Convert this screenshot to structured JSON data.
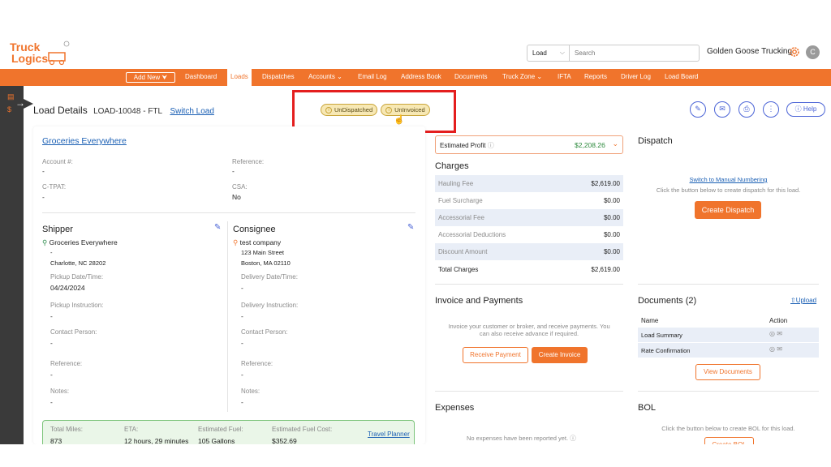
{
  "topbar": {
    "logo_text": "Truck Logics",
    "search_scope": "Load",
    "search_placeholder": "Search",
    "company": "Golden Goose Trucking",
    "avatar_initial": "C"
  },
  "nav": {
    "add_new": "Add New ⮟",
    "items": [
      "Dashboard",
      "Loads",
      "Dispatches",
      "Accounts ⌄",
      "Email Log",
      "Address Book",
      "Documents",
      "Truck Zone ⌄",
      "IFTA",
      "Reports",
      "Driver Log",
      "Load Board"
    ],
    "active": "Loads"
  },
  "header": {
    "title": "Load Details",
    "load_id": "LOAD-10048 - FTL",
    "switch_link": "Switch Load",
    "status_dispatch": "UnDispatched",
    "status_invoice": "UnInvoiced",
    "help": "Help"
  },
  "customer": {
    "name": "Groceries Everywhere",
    "account_label": "Account #:",
    "account_value": "-",
    "reference_label": "Reference:",
    "reference_value": "-",
    "ctpat_label": "C-TPAT:",
    "ctpat_value": "-",
    "csa_label": "CSA:",
    "csa_value": "No"
  },
  "shipper": {
    "title": "Shipper",
    "name": "Groceries Everywhere",
    "line1": "-",
    "line2": "Charlotte, NC 28202",
    "date_label": "Pickup Date/Time:",
    "date_value": "04/24/2024",
    "instr_label": "Pickup Instruction:",
    "instr_value": "-",
    "contact_label": "Contact Person:",
    "contact_value": "-",
    "ref_label": "Reference:",
    "ref_value": "-",
    "notes_label": "Notes:",
    "notes_value": "-"
  },
  "consignee": {
    "title": "Consignee",
    "name": "test company",
    "line1": "123 Main Street",
    "line2": "Boston, MA 02110",
    "date_label": "Delivery Date/Time:",
    "date_value": "-",
    "instr_label": "Delivery Instruction:",
    "instr_value": "-",
    "contact_label": "Contact Person:",
    "contact_value": "-",
    "ref_label": "Reference:",
    "ref_value": "-",
    "notes_label": "Notes:",
    "notes_value": "-"
  },
  "trip": {
    "miles_label": "Total Miles:",
    "miles_value": "873",
    "eta_label": "ETA:",
    "eta_value": "12 hours, 29 minutes",
    "fuel_label": "Estimated Fuel:",
    "fuel_value": "105 Gallons",
    "fuelcost_label": "Estimated Fuel Cost:",
    "fuelcost_value": "$352.69",
    "planner_link": "Travel Planner"
  },
  "profit": {
    "label": "Estimated Profit",
    "value": "$2,208.26"
  },
  "charges": {
    "title": "Charges",
    "rows": [
      {
        "name": "Hauling Fee",
        "value": "$2,619.00"
      },
      {
        "name": "Fuel Surcharge",
        "value": "$0.00"
      },
      {
        "name": "Accessorial Fee",
        "value": "$0.00"
      },
      {
        "name": "Accessorial Deductions",
        "value": "$0.00"
      },
      {
        "name": "Discount Amount",
        "value": "$0.00"
      }
    ],
    "total_label": "Total Charges",
    "total_value": "$2,619.00"
  },
  "invoice": {
    "title": "Invoice and Payments",
    "text1": "Invoice your customer or broker, and receive payments. You",
    "text2": "can also receive advance if required.",
    "receive_btn": "Receive Payment",
    "create_btn": "Create Invoice"
  },
  "expenses": {
    "title": "Expenses",
    "empty": "No expenses have been reported yet."
  },
  "dispatch": {
    "title": "Dispatch",
    "switch_link": "Switch to Manual Numbering",
    "hint": "Click the button below to create dispatch for this load.",
    "create_btn": "Create Dispatch"
  },
  "documents": {
    "title": "Documents (2)",
    "upload": "⇧Upload",
    "col_name": "Name",
    "col_action": "Action",
    "rows": [
      "Load Summary",
      "Rate Confirmation"
    ],
    "view_btn": "View Documents"
  },
  "bol": {
    "title": "BOL",
    "hint": "Click the button below to create BOL for this load.",
    "create_btn": "Create BOL"
  },
  "colors": {
    "accent": "#f0742c",
    "link": "#1a5fb4",
    "profit": "#2e8b3e",
    "highlight": "#e41e1e"
  }
}
